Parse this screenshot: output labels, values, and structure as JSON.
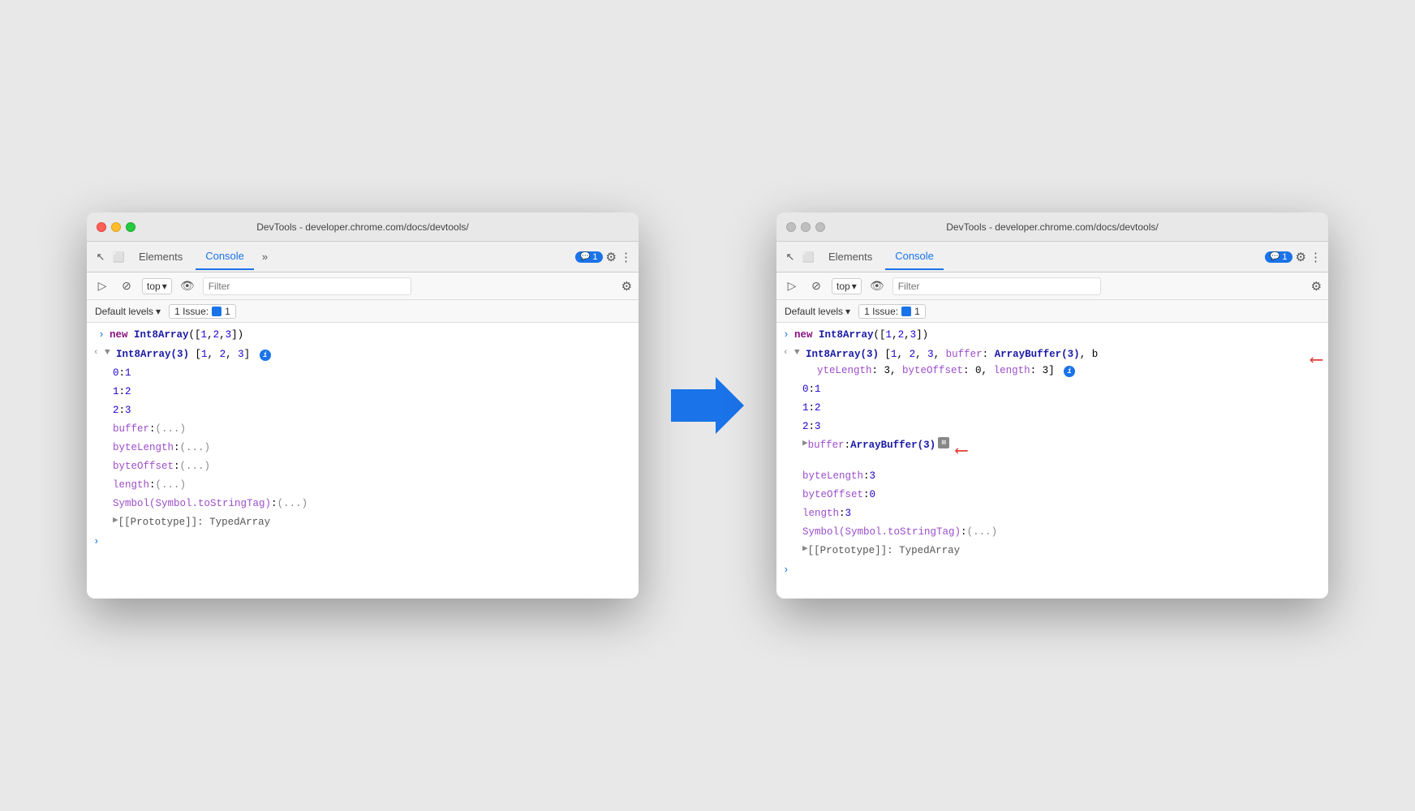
{
  "left_window": {
    "title": "DevTools - developer.chrome.com/docs/devtools/",
    "active": true,
    "tabs": {
      "elements_label": "Elements",
      "console_label": "Console",
      "more_label": "»",
      "badge_count": "1"
    },
    "toolbar": {
      "top_label": "top",
      "filter_placeholder": "Filter"
    },
    "issues": {
      "default_levels": "Default levels",
      "issue_count": "1 Issue:",
      "issue_num": "1"
    },
    "console_lines": [
      {
        "type": "input",
        "arrow": "›",
        "text": "new Int8Array([1,2,3])"
      },
      {
        "type": "expand_header",
        "text": "Int8Array(3) [1, 2, 3]"
      },
      {
        "type": "prop",
        "label": "0:",
        "value": "1"
      },
      {
        "type": "prop",
        "label": "1:",
        "value": "2"
      },
      {
        "type": "prop",
        "label": "2:",
        "value": "3"
      },
      {
        "type": "prop_lazy",
        "label": "buffer:",
        "value": "(...)"
      },
      {
        "type": "prop_lazy",
        "label": "byteLength:",
        "value": "(...)"
      },
      {
        "type": "prop_lazy",
        "label": "byteOffset:",
        "value": "(...)"
      },
      {
        "type": "prop_lazy",
        "label": "length:",
        "value": "(...)"
      },
      {
        "type": "prop_lazy",
        "label": "Symbol(Symbol.toStringTag):",
        "value": "(...)"
      },
      {
        "type": "proto",
        "text": "[[Prototype]]: TypedArray"
      }
    ]
  },
  "right_window": {
    "title": "DevTools - developer.chrome.com/docs/devtools/",
    "active": false,
    "tabs": {
      "elements_label": "Elements",
      "console_label": "Console",
      "badge_count": "1"
    },
    "toolbar": {
      "top_label": "top",
      "filter_placeholder": "Filter"
    },
    "issues": {
      "default_levels": "Default levels",
      "issue_count": "1 Issue:",
      "issue_num": "1"
    },
    "console_lines_top": "new Int8Array([1,2,3])",
    "header_line": "Int8Array(3) [1, 2, 3, buffer: ArrayBuffer(3), byteLength: 3, byteOffset: 0, length: 3]",
    "props": [
      {
        "label": "0:",
        "value": "1"
      },
      {
        "label": "1:",
        "value": "2"
      },
      {
        "label": "2:",
        "value": "3"
      }
    ],
    "buffer_line": "buffer: ArrayBuffer(3)",
    "other_props": [
      {
        "label": "byteLength:",
        "value": "3"
      },
      {
        "label": "byteOffset:",
        "value": "0"
      },
      {
        "label": "length:",
        "value": "3"
      }
    ],
    "symbol_line": "Symbol(Symbol.toStringTag): (...)",
    "proto_line": "[[Prototype]]: TypedArray"
  },
  "arrow": "→",
  "icons": {
    "gear": "⚙",
    "more": "⋮",
    "chevron": "▾",
    "expand": "›",
    "collapse": "‹",
    "triangle_right": "▶",
    "triangle_down": "▼",
    "eye": "👁",
    "ban": "🚫",
    "cursor": "↖"
  }
}
